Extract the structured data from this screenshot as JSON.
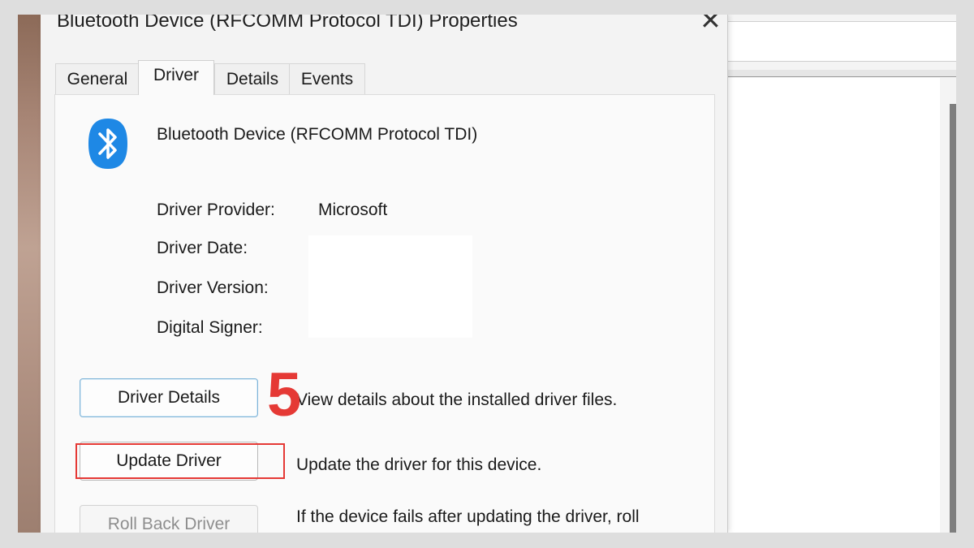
{
  "dialog": {
    "title": "Bluetooth Device (RFCOMM Protocol TDI) Properties",
    "close_glyph": "✕",
    "tabs": [
      {
        "label": "General",
        "active": false
      },
      {
        "label": "Driver",
        "active": true
      },
      {
        "label": "Details",
        "active": false
      },
      {
        "label": "Events",
        "active": false
      }
    ],
    "device_icon": "bluetooth-icon",
    "device_name": "Bluetooth Device (RFCOMM Protocol TDI)",
    "properties": [
      {
        "label": "Driver Provider:",
        "value": "Microsoft"
      },
      {
        "label": "Driver Date:",
        "value": ""
      },
      {
        "label": "Driver Version:",
        "value": ""
      },
      {
        "label": "Digital Signer:",
        "value": ""
      }
    ],
    "actions": [
      {
        "label": "Driver Details",
        "description": "View details about the installed driver files.",
        "enabled": true
      },
      {
        "label": "Update Driver",
        "description": "Update the driver for this device.",
        "enabled": true,
        "highlighted": true
      },
      {
        "label": "Roll Back Driver",
        "description": "If the device fails after updating the driver, roll",
        "enabled": false
      }
    ]
  },
  "annotation": {
    "step_number": "5",
    "color": "#e53935"
  },
  "colors": {
    "accent_blue": "#1e88e5",
    "highlight_red": "#e53935"
  }
}
